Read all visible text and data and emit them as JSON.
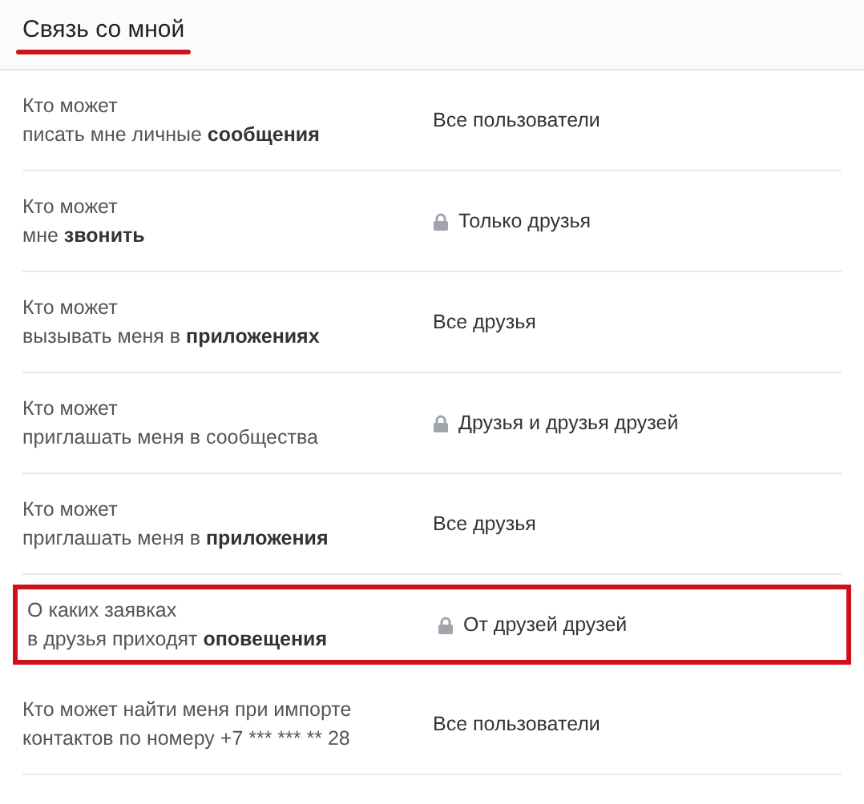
{
  "header": {
    "title": "Связь со мной",
    "underlined": true
  },
  "rows": [
    {
      "label": "Кто может\nписать мне личные **сообщения**",
      "value": "Все пользователи",
      "locked": false,
      "highlighted": false
    },
    {
      "label": "Кто может\nмне **звонить**",
      "value": "Только друзья",
      "locked": true,
      "highlighted": false
    },
    {
      "label": "Кто может\nвызывать меня в **приложениях**",
      "value": "Все друзья",
      "locked": false,
      "highlighted": false
    },
    {
      "label": "Кто может\nприглашать меня в сообщества",
      "value": "Друзья и друзья друзей",
      "locked": true,
      "highlighted": false
    },
    {
      "label": "Кто может\nприглашать меня в **приложения**",
      "value": "Все друзья",
      "locked": false,
      "highlighted": false
    },
    {
      "label": "О каких заявках\nв друзья приходят **оповещения**",
      "value": "От друзей друзей",
      "locked": true,
      "highlighted": true
    },
    {
      "label": "Кто может найти меня при импорте\nконтактов по номеру +7 *** *** ** 28",
      "kind": "plain",
      "value": "Все пользователи",
      "locked": false,
      "highlighted": false
    }
  ]
}
